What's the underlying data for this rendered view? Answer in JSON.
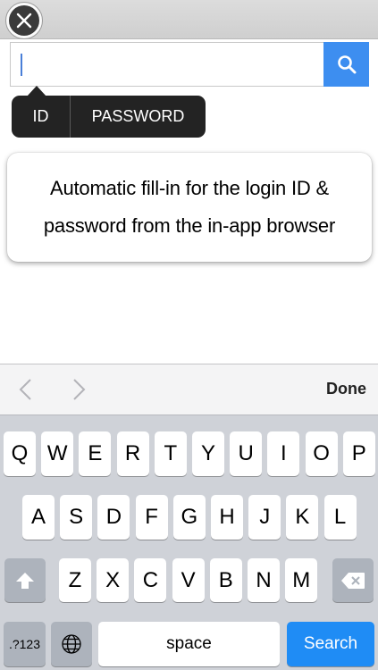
{
  "search": {
    "value": "",
    "placeholder": ""
  },
  "fill_menu": {
    "id_label": "ID",
    "password_label": "PASSWORD"
  },
  "info_card": {
    "line1": "Automatic fill-in for the login ID &",
    "line2": "password from the in-app browser"
  },
  "accessory": {
    "done_label": "Done"
  },
  "keyboard": {
    "row1": [
      "Q",
      "W",
      "E",
      "R",
      "T",
      "Y",
      "U",
      "I",
      "O",
      "P"
    ],
    "row2": [
      "A",
      "S",
      "D",
      "F",
      "G",
      "H",
      "J",
      "K",
      "L"
    ],
    "row3": [
      "Z",
      "X",
      "C",
      "V",
      "B",
      "N",
      "M"
    ],
    "numbers_label": ".?123",
    "space_label": "space",
    "search_label": "Search"
  },
  "colors": {
    "search_button": "#3d8ef0",
    "search_key": "#1f8cf5",
    "callout": "#232323",
    "keyboard_bg": "#cfd2d8"
  },
  "icons": {
    "close": "close-icon",
    "search": "magnifier-icon",
    "prev": "chevron-left-icon",
    "next": "chevron-right-icon",
    "shift": "shift-arrow-icon",
    "delete": "backspace-icon",
    "globe": "globe-icon"
  }
}
